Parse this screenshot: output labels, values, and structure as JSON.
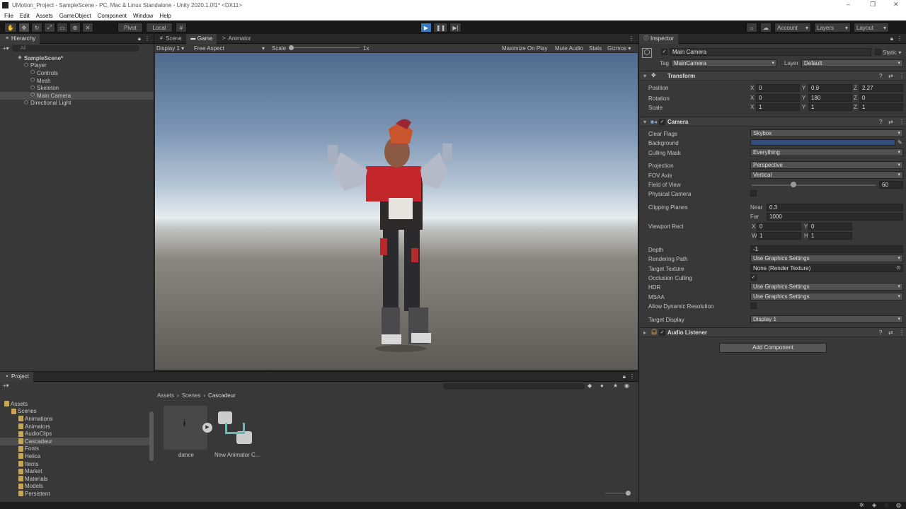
{
  "window": {
    "title": "UMotion_Project - SampleScene - PC, Mac & Linux Standalone - Unity 2020.1.0f1* <DX11>"
  },
  "menu": [
    "File",
    "Edit",
    "Assets",
    "GameObject",
    "Component",
    "Window",
    "Help"
  ],
  "toolbar": {
    "pivot": "Pivot",
    "local": "Local",
    "account": "Account",
    "layers": "Layers",
    "layout": "Layout"
  },
  "hierarchy": {
    "tab": "Hierarchy",
    "search_placeholder": "All",
    "items": [
      {
        "label": "SampleScene*",
        "depth": 0,
        "icon": "scene-icon"
      },
      {
        "label": "Player",
        "depth": 1,
        "icon": "gameobject-icon"
      },
      {
        "label": "Controls",
        "depth": 2,
        "icon": "gameobject-icon"
      },
      {
        "label": "Mesh",
        "depth": 2,
        "icon": "gameobject-icon"
      },
      {
        "label": "Skeleton",
        "depth": 2,
        "icon": "gameobject-icon"
      },
      {
        "label": "Main Camera",
        "depth": 2,
        "icon": "gameobject-icon"
      },
      {
        "label": "Directional Light",
        "depth": 1,
        "icon": "gameobject-icon"
      }
    ]
  },
  "game": {
    "tabs": [
      "Scene",
      "Game",
      "Animator"
    ],
    "display": "Display 1",
    "aspect": "Free Aspect",
    "scale_label": "Scale",
    "scale_value": "1x",
    "maximize": "Maximize On Play",
    "mute": "Mute Audio",
    "stats": "Stats",
    "gizmos": "Gizmos"
  },
  "inspector": {
    "tab": "Inspector",
    "object_name": "Main Camera",
    "static": "Static",
    "tag_label": "Tag",
    "tag": "MainCamera",
    "layer_label": "Layer",
    "layer": "Default",
    "transform": {
      "title": "Transform",
      "position_label": "Position",
      "rotation_label": "Rotation",
      "scale_label": "Scale",
      "position": [
        "0",
        "0.9",
        "2.27"
      ],
      "rotation": [
        "0",
        "180",
        "0"
      ],
      "scale": [
        "1",
        "1",
        "1"
      ]
    },
    "camera": {
      "title": "Camera",
      "clear_flags_label": "Clear Flags",
      "clear_flags": "Skybox",
      "background_label": "Background",
      "background_color": "#314d79",
      "culling_mask_label": "Culling Mask",
      "culling_mask": "Everything",
      "projection_label": "Projection",
      "projection": "Perspective",
      "fov_axis_label": "FOV Axis",
      "fov_axis": "Vertical",
      "fov_label": "Field of View",
      "fov": "60",
      "physical_label": "Physical Camera",
      "clipping_label": "Clipping Planes",
      "near_label": "Near",
      "near": "0.3",
      "far_label": "Far",
      "far": "1000",
      "viewport_label": "Viewport Rect",
      "vx": "0",
      "vy": "0",
      "vw": "1",
      "vh": "1",
      "depth_label": "Depth",
      "depth": "-1",
      "rendering_path_label": "Rendering Path",
      "rendering_path": "Use Graphics Settings",
      "target_texture_label": "Target Texture",
      "target_texture": "None (Render Texture)",
      "occlusion_label": "Occlusion Culling",
      "hdr_label": "HDR",
      "hdr": "Use Graphics Settings",
      "msaa_label": "MSAA",
      "msaa": "Use Graphics Settings",
      "dynres_label": "Allow Dynamic Resolution",
      "target_display_label": "Target Display",
      "target_display": "Display 1"
    },
    "audio_listener": {
      "title": "Audio Listener"
    },
    "add_component": "Add Component"
  },
  "project": {
    "tab": "Project",
    "breadcrumb": [
      "Assets",
      "Scenes",
      "Cascadeur"
    ],
    "tree": [
      {
        "label": "Assets",
        "depth": 0
      },
      {
        "label": "Scenes",
        "depth": 1
      },
      {
        "label": "Animations",
        "depth": 2
      },
      {
        "label": "Animators",
        "depth": 2
      },
      {
        "label": "AudioClips",
        "depth": 2
      },
      {
        "label": "Cascadeur",
        "depth": 2
      },
      {
        "label": "Fonts",
        "depth": 2
      },
      {
        "label": "Helica",
        "depth": 2
      },
      {
        "label": "Items",
        "depth": 2
      },
      {
        "label": "Market",
        "depth": 2
      },
      {
        "label": "Materials",
        "depth": 2
      },
      {
        "label": "Models",
        "depth": 2
      },
      {
        "label": "Persistent",
        "depth": 2
      }
    ],
    "assets": [
      {
        "label": "dance"
      },
      {
        "label": "New Animator C..."
      }
    ]
  }
}
